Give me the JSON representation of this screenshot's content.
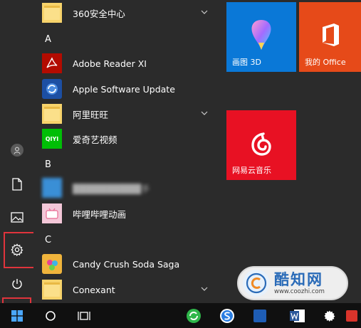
{
  "rail": {
    "items": [
      {
        "name": "user",
        "icon": "user-icon"
      },
      {
        "name": "documents",
        "icon": "document-icon"
      },
      {
        "name": "pictures",
        "icon": "picture-icon"
      },
      {
        "name": "settings",
        "icon": "gear-icon"
      },
      {
        "name": "power",
        "icon": "power-icon"
      }
    ]
  },
  "app_list": {
    "item_360": "360安全中心",
    "letter_a": "A",
    "adobe": "Adobe Reader XI",
    "apple": "Apple Software Update",
    "alibaba": "阿里旺旺",
    "iqiyi": "爱奇艺视频",
    "letter_b": "B",
    "blurred_app": "██████████手",
    "bilibili": "哔哩哔哩动画",
    "letter_c": "C",
    "candy": "Candy Crush Soda Saga",
    "conexant": "Conexant",
    "iqiyi_icon_text": "QIYI"
  },
  "tiles": {
    "paint3d": "画图 3D",
    "office": "我的 Office",
    "netease": "网易云音乐"
  },
  "watermark": {
    "title": "酷知网",
    "url": "www.coozhi.com"
  },
  "colors": {
    "background": "#2b2b2b",
    "tile_blue": "#0a78d7",
    "tile_office": "#e64a19",
    "tile_netease": "#e81123",
    "highlight": "#e0343c",
    "taskbar": "#101010"
  }
}
